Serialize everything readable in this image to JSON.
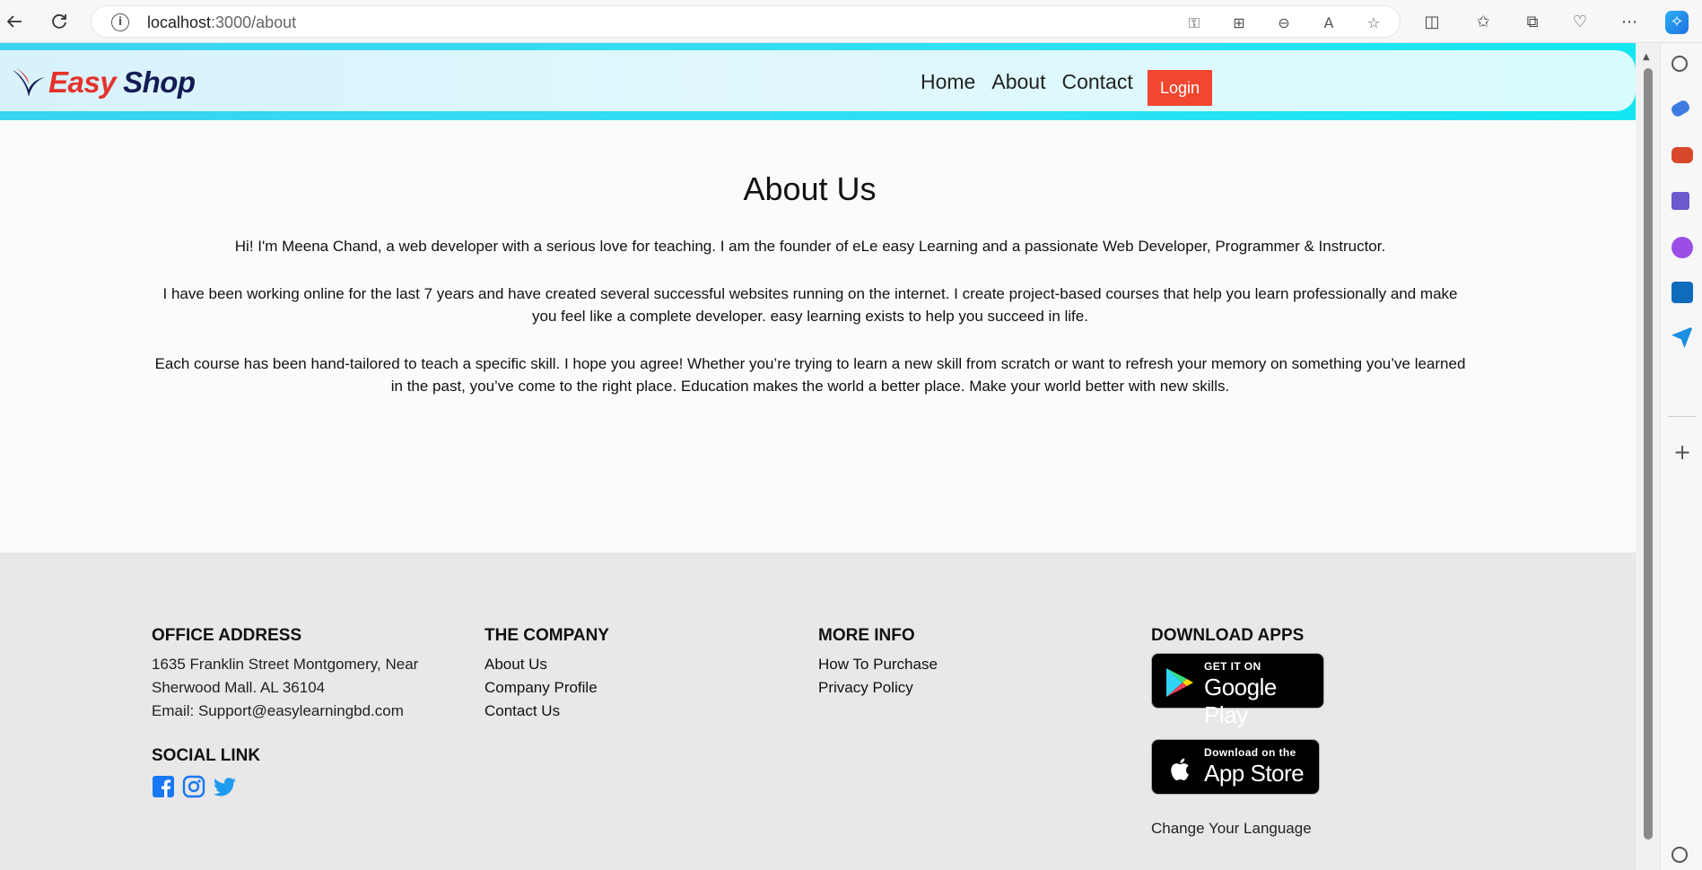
{
  "browser": {
    "url_host": "localhost",
    "url_path": ":3000/about"
  },
  "site": {
    "logo_easy": "Easy",
    "logo_shop": "Shop",
    "nav": [
      "Home",
      "About",
      "Contact"
    ],
    "login_label": "Login",
    "colors": {
      "brand_red": "#e5322c",
      "brand_navy": "#141b55",
      "login_bg": "#f0472e",
      "header_cyan": "#2fe0f5"
    }
  },
  "about": {
    "title": "About Us",
    "paragraphs": [
      "Hi! I'm Meena Chand, a web developer with a serious love for teaching. I am the founder of eLe easy Learning and a passionate Web Developer, Programmer & Instructor.",
      "I have been working online for the last 7 years and have created several successful websites running on the internet. I create project-based courses that help you learn professionally and make you feel like a complete developer. easy learning exists to help you succeed in life.",
      "Each course has been hand-tailored to teach a specific skill. I hope you agree! Whether you’re trying to learn a new skill from scratch or want to refresh your memory on something you’ve learned in the past, you’ve come to the right place. Education makes the world a better place. Make your world better with new skills."
    ]
  },
  "footer": {
    "office": {
      "heading": "OFFICE ADDRESS",
      "line1": "1635 Franklin Street Montgomery, Near",
      "line2": "Sherwood Mall. AL 36104",
      "line3": "Email: Support@easylearningbd.com"
    },
    "social": {
      "heading": "SOCIAL LINK",
      "icons": [
        "facebook-icon",
        "instagram-icon",
        "twitter-icon"
      ]
    },
    "company": {
      "heading": "THE COMPANY",
      "links": [
        "About Us",
        "Company Profile",
        "Contact Us"
      ]
    },
    "more": {
      "heading": "MORE INFO",
      "links": [
        "How To Purchase",
        "Privacy Policy"
      ]
    },
    "apps": {
      "heading": "DOWNLOAD APPS",
      "google_small": "GET IT ON",
      "google_big": "Google Play",
      "apple_small": "Download on the",
      "apple_big": "App Store",
      "language": "Change Your Language"
    }
  }
}
